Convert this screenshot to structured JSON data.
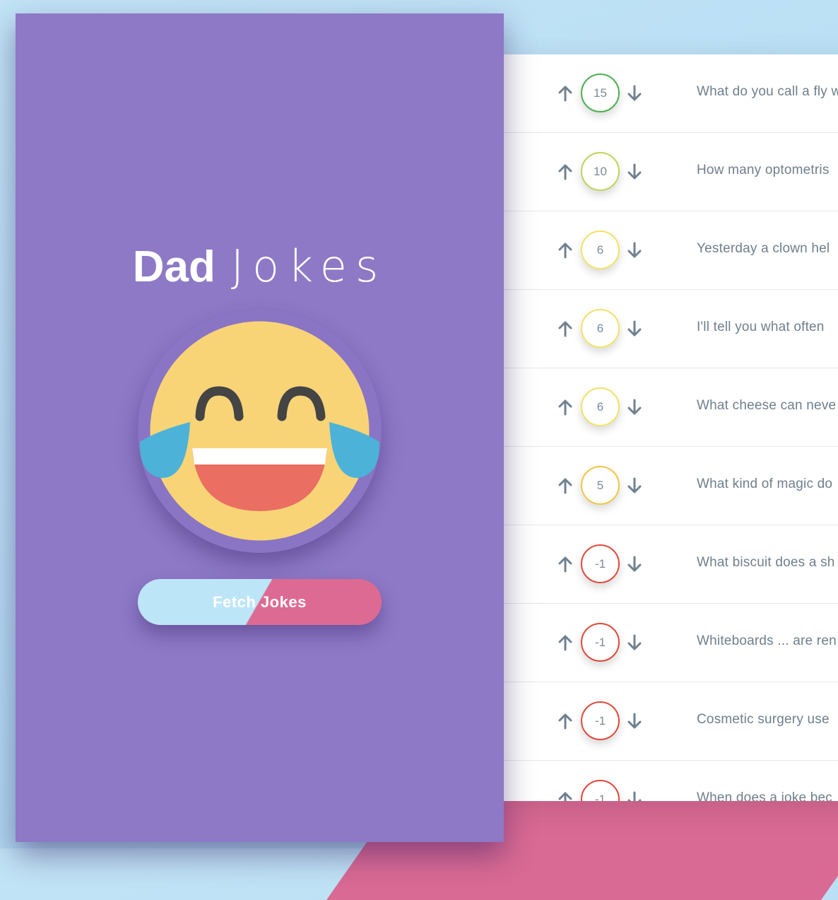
{
  "sidebar": {
    "title_bold": "Dad",
    "title_light": "Jokes",
    "emoji_icon": "laughing-with-tears-emoji",
    "fetch_button_label": "Fetch Jokes"
  },
  "colors": {
    "sidebar_bg": "#8d79c6",
    "button_left": "#bde5f8",
    "button_right": "#dd6a92",
    "emoji_face": "#f8d477",
    "emoji_tears": "#4db2d8",
    "emoji_mouth": "#ea6e61"
  },
  "jokes": [
    {
      "score": "15",
      "score_color": "#4caf50",
      "text": "What do you call a fly w"
    },
    {
      "score": "10",
      "score_color": "#c0d45a",
      "text": "How many optometris"
    },
    {
      "score": "6",
      "score_color": "#f1e467",
      "text": "Yesterday a clown hel"
    },
    {
      "score": "6",
      "score_color": "#f1e467",
      "text": "I'll tell you what often"
    },
    {
      "score": "6",
      "score_color": "#f1e467",
      "text": "What cheese can neve"
    },
    {
      "score": "5",
      "score_color": "#f2c546",
      "text": "What kind of magic do"
    },
    {
      "score": "-1",
      "score_color": "#e04a3a",
      "text": "What biscuit does a sh"
    },
    {
      "score": "-1",
      "score_color": "#e04a3a",
      "text": "Whiteboards ... are ren"
    },
    {
      "score": "-1",
      "score_color": "#e04a3a",
      "text": "Cosmetic surgery use"
    },
    {
      "score": "-1",
      "score_color": "#e04a3a",
      "text": "When does a joke bec"
    }
  ],
  "icons": {
    "upvote": "arrow-up-icon",
    "downvote": "arrow-down-icon"
  }
}
